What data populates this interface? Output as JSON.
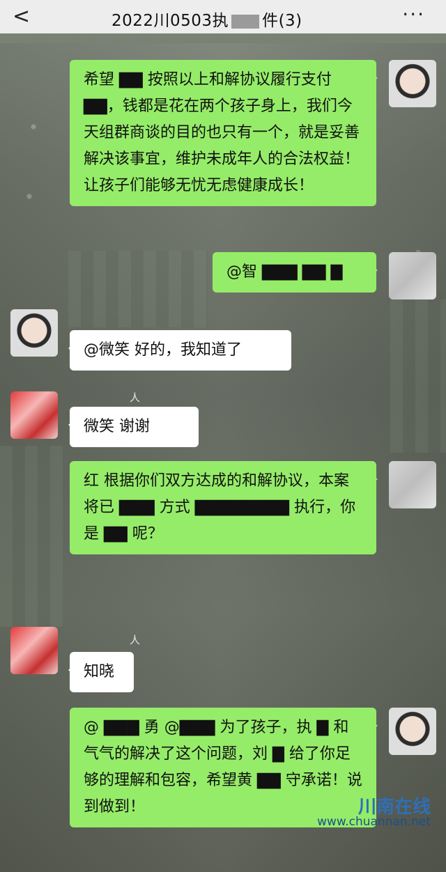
{
  "header": {
    "back": "<",
    "title_prefix": "2022川0503执",
    "title_suffix": "件(3)",
    "more": "···"
  },
  "messages": [
    {
      "side": "right",
      "text": "希望 ▇▇ 按照以上和解协议履行支付 ▇▇，钱都是花在两个孩子身上，我们今天组群商谈的目的也只有一个，就是妥善解决该事宜，维护未成年人的合法权益！让孩子们能够无忧无虑健康成长！"
    },
    {
      "side": "right",
      "text": "@智 ▇▇▇ ▇▇ ▇"
    },
    {
      "side": "left",
      "text": "@微笑  好的，我知道了"
    },
    {
      "side": "left",
      "nickname": "人",
      "text": "微笑  谢谢"
    },
    {
      "side": "right",
      "text": "红  根据你们双方达成的和解协议，本案将已 ▇▇▇ 方式 ▇▇▇▇▇▇▇▇ 执行，你是 ▇▇ 呢？"
    },
    {
      "side": "left",
      "nickname": "人",
      "text": "知晓"
    },
    {
      "side": "right",
      "text": "@ ▇▇▇ 勇 @▇▇▇ 为了孩子，执 ▇ 和气气的解决了这个问题，刘 ▇ 给了你足够的理解和包容，希望黄 ▇▇ 守承诺！说到做到！"
    }
  ],
  "watermark": {
    "name": "川南在线",
    "url": "www.chuannan.net"
  }
}
